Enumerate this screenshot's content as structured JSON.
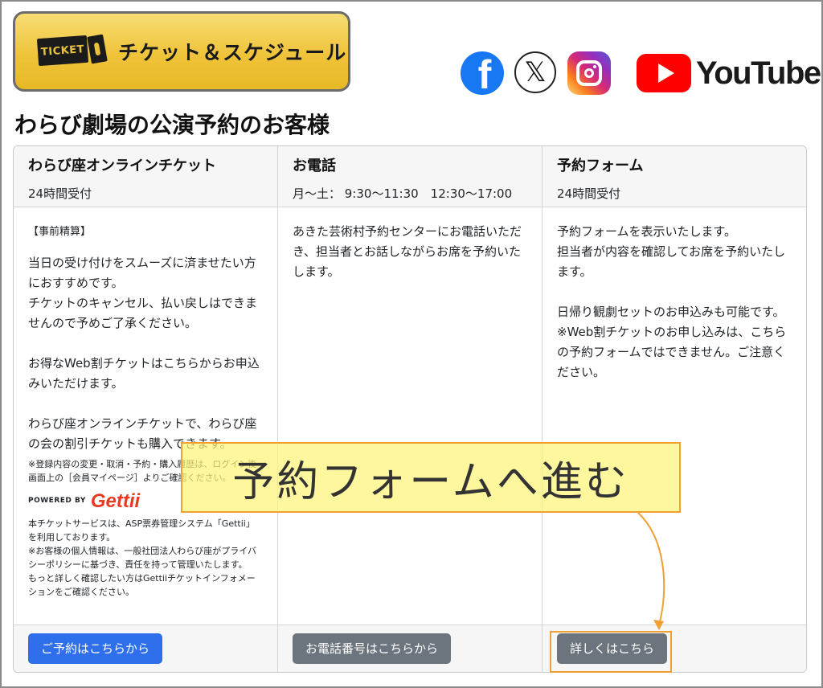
{
  "banner": {
    "badge_text": "TICKET",
    "label": "チケット＆スケジュール"
  },
  "social": {
    "youtube_word": "YouTube",
    "x_glyph": "𝕏",
    "facebook_glyph": "f"
  },
  "page_title": "わらび劇場の公演予約のお客様",
  "columns": [
    {
      "title": "わらび座オンラインチケット",
      "subtitle": "24時間受付",
      "tag": "【事前精算】",
      "paragraphs": [
        "当日の受け付けをスムーズに済ませたい方におすすめです。\nチケットのキャンセル、払い戻しはできませんので予めご了承ください。",
        "お得なWeb割チケットはこちらからお申込みいただけます。",
        "わらび座オンラインチケットで、わらび座の会の割引チケットも購入できます。"
      ],
      "note_1": "※登録内容の変更・取消・予約・購入履歴は、ログイン後画面上の［会員マイページ］よりご確認ください。",
      "powered_by": "POWERED BY",
      "gettii": "Gettii",
      "note_2": "本チケットサービスは、ASP票券管理システム「Gettii」を利用しております。\n※お客様の個人情報は、一般社団法人わらび座がプライバシーポリシーに基づき、責任を持って管理いたします。\nもっと詳しく確認したい方はGettiiチケットインフォメーションをご確認ください。",
      "button": "ご予約はこちらから"
    },
    {
      "title": "お電話",
      "subtitle": "月〜土： 9:30〜11:30　12:30〜17:00",
      "paragraphs": [
        "あきた芸術村予約センターにお電話いただき、担当者とお話しながらお席を予約いたします。"
      ],
      "button": "お電話番号はこちらから"
    },
    {
      "title": "予約フォーム",
      "subtitle": "24時間受付",
      "paragraphs": [
        "予約フォームを表示いたします。\n担当者が内容を確認してお席を予約いたします。",
        "日帰り観劇セットのお申込みも可能です。\n※Web割チケットのお申し込みは、こちらの予約フォームではできません。ご注意ください。"
      ],
      "button": "詳しくはこちら"
    }
  ],
  "callout": "予約フォームへ進む",
  "colors": {
    "primary_button": "#2f6feb",
    "secondary_button": "#6c757d",
    "highlight": "#f0a030"
  }
}
